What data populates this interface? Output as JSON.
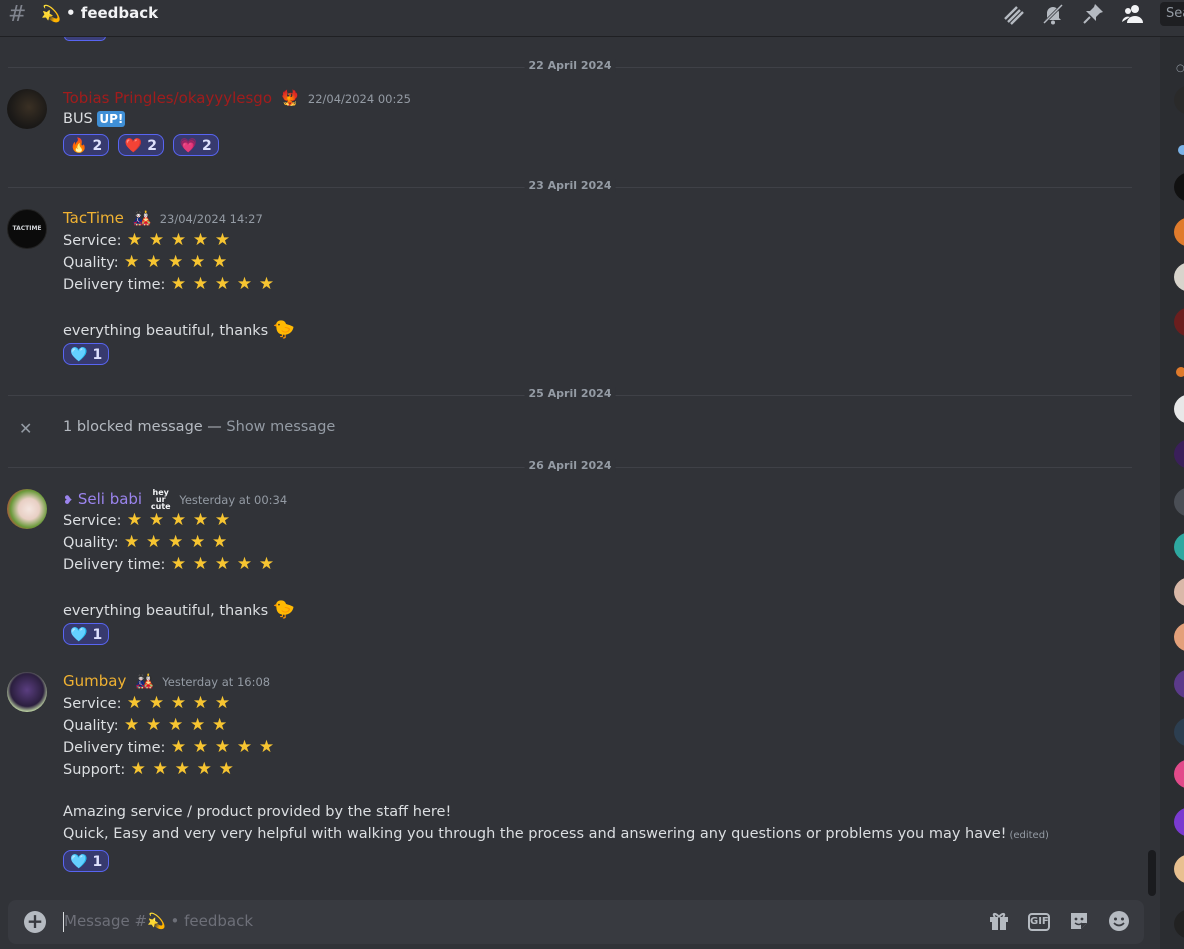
{
  "header": {
    "hash_icon": "hashtag-icon",
    "channel_emoji": "💫",
    "channel_name": "• feedback",
    "icons": [
      "threads-icon",
      "mute-bell-icon",
      "pin-icon",
      "members-icon"
    ],
    "search_placeholder": "Sea"
  },
  "dividers": [
    "22 April 2024",
    "23 April 2024",
    "25 April 2024",
    "26 April 2024"
  ],
  "messages": [
    {
      "username": "Tobias Pringles/okayyylesgo",
      "username_color": "#a11c1c",
      "badge": "🐦‍🔥",
      "timestamp": "22/04/2024 00:25",
      "text_main": "BUS ",
      "text_tag": "UP!",
      "reactions": [
        {
          "emoji": "🔥",
          "count": "2"
        },
        {
          "emoji": "❤️",
          "count": "2"
        },
        {
          "emoji": "💗",
          "count": "2"
        }
      ]
    },
    {
      "username": "TacTime",
      "username_color": "#f0b232",
      "badge": "🎎",
      "timestamp": "23/04/2024 14:27",
      "avatar_text": "TACTIME",
      "lines": [
        "Service:",
        "Quality:",
        "Delivery time:"
      ],
      "stars": [
        5,
        5,
        5
      ],
      "closing": "everything beautiful, thanks",
      "closing_emoji": "🐤",
      "reactions": [
        {
          "emoji": "🩵",
          "count": "1"
        }
      ]
    },
    {
      "blocked_text": "1 blocked message — ",
      "show_text": "Show message",
      "close_icon": "close-icon"
    },
    {
      "username_prefix": "❥",
      "username": "Seli babi",
      "username_color": "#9b84ee",
      "badge_text": "hey ur cute",
      "timestamp": "Yesterday at 00:34",
      "lines": [
        "Service:",
        "Quality:",
        "Delivery time:"
      ],
      "stars": [
        5,
        5,
        5
      ],
      "closing": "everything beautiful, thanks",
      "closing_emoji": "🐤",
      "reactions": [
        {
          "emoji": "🩵",
          "count": "1"
        }
      ]
    },
    {
      "username": "Gumbay",
      "username_color": "#f0b232",
      "badge": "🎎",
      "timestamp": "Yesterday at 16:08",
      "lines": [
        "Service:",
        "Quality:",
        "Delivery time:",
        "Support:"
      ],
      "stars": [
        5,
        5,
        5,
        5
      ],
      "body_1": "Amazing service / product provided by the staff here!",
      "body_2": "Quick, Easy and very very helpful with walking you through the process and answering any questions or problems you may have!",
      "edited": "(edited)",
      "reactions": [
        {
          "emoji": "🩵",
          "count": "1"
        }
      ]
    }
  ],
  "composer": {
    "placeholder": "Message #💫 • feedback",
    "icons": [
      "gift-icon",
      "gif-icon",
      "sticker-icon",
      "emoji-icon"
    ],
    "gif_label": "GIF",
    "plus_label": "+"
  },
  "colors": {
    "background": "#313338",
    "accent": "#5865f2",
    "star": "#f7c531"
  }
}
